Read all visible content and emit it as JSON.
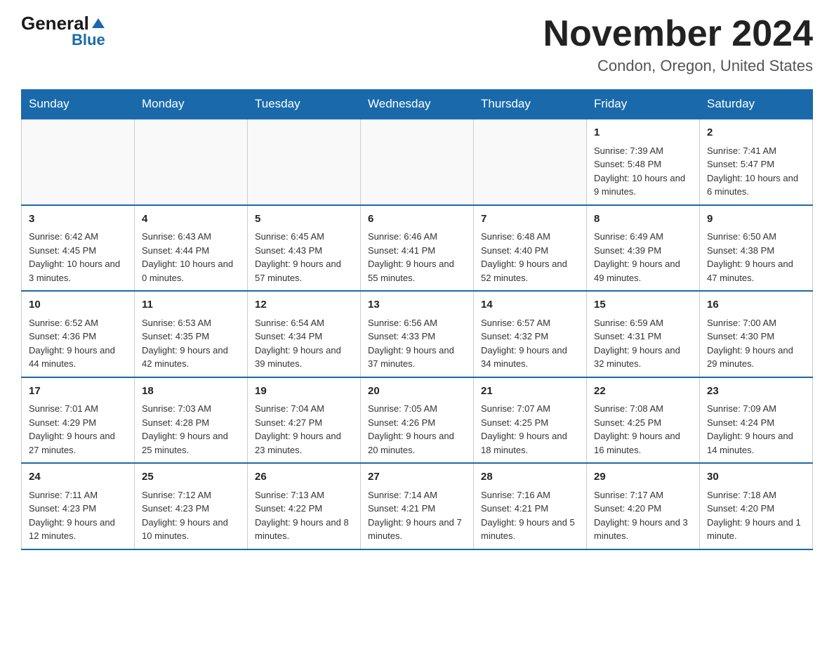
{
  "header": {
    "logo_general": "General",
    "logo_blue": "Blue",
    "month_title": "November 2024",
    "location": "Condon, Oregon, United States"
  },
  "weekdays": [
    "Sunday",
    "Monday",
    "Tuesday",
    "Wednesday",
    "Thursday",
    "Friday",
    "Saturday"
  ],
  "weeks": [
    [
      {
        "day": "",
        "sunrise": "",
        "sunset": "",
        "daylight": ""
      },
      {
        "day": "",
        "sunrise": "",
        "sunset": "",
        "daylight": ""
      },
      {
        "day": "",
        "sunrise": "",
        "sunset": "",
        "daylight": ""
      },
      {
        "day": "",
        "sunrise": "",
        "sunset": "",
        "daylight": ""
      },
      {
        "day": "",
        "sunrise": "",
        "sunset": "",
        "daylight": ""
      },
      {
        "day": "1",
        "sunrise": "Sunrise: 7:39 AM",
        "sunset": "Sunset: 5:48 PM",
        "daylight": "Daylight: 10 hours and 9 minutes."
      },
      {
        "day": "2",
        "sunrise": "Sunrise: 7:41 AM",
        "sunset": "Sunset: 5:47 PM",
        "daylight": "Daylight: 10 hours and 6 minutes."
      }
    ],
    [
      {
        "day": "3",
        "sunrise": "Sunrise: 6:42 AM",
        "sunset": "Sunset: 4:45 PM",
        "daylight": "Daylight: 10 hours and 3 minutes."
      },
      {
        "day": "4",
        "sunrise": "Sunrise: 6:43 AM",
        "sunset": "Sunset: 4:44 PM",
        "daylight": "Daylight: 10 hours and 0 minutes."
      },
      {
        "day": "5",
        "sunrise": "Sunrise: 6:45 AM",
        "sunset": "Sunset: 4:43 PM",
        "daylight": "Daylight: 9 hours and 57 minutes."
      },
      {
        "day": "6",
        "sunrise": "Sunrise: 6:46 AM",
        "sunset": "Sunset: 4:41 PM",
        "daylight": "Daylight: 9 hours and 55 minutes."
      },
      {
        "day": "7",
        "sunrise": "Sunrise: 6:48 AM",
        "sunset": "Sunset: 4:40 PM",
        "daylight": "Daylight: 9 hours and 52 minutes."
      },
      {
        "day": "8",
        "sunrise": "Sunrise: 6:49 AM",
        "sunset": "Sunset: 4:39 PM",
        "daylight": "Daylight: 9 hours and 49 minutes."
      },
      {
        "day": "9",
        "sunrise": "Sunrise: 6:50 AM",
        "sunset": "Sunset: 4:38 PM",
        "daylight": "Daylight: 9 hours and 47 minutes."
      }
    ],
    [
      {
        "day": "10",
        "sunrise": "Sunrise: 6:52 AM",
        "sunset": "Sunset: 4:36 PM",
        "daylight": "Daylight: 9 hours and 44 minutes."
      },
      {
        "day": "11",
        "sunrise": "Sunrise: 6:53 AM",
        "sunset": "Sunset: 4:35 PM",
        "daylight": "Daylight: 9 hours and 42 minutes."
      },
      {
        "day": "12",
        "sunrise": "Sunrise: 6:54 AM",
        "sunset": "Sunset: 4:34 PM",
        "daylight": "Daylight: 9 hours and 39 minutes."
      },
      {
        "day": "13",
        "sunrise": "Sunrise: 6:56 AM",
        "sunset": "Sunset: 4:33 PM",
        "daylight": "Daylight: 9 hours and 37 minutes."
      },
      {
        "day": "14",
        "sunrise": "Sunrise: 6:57 AM",
        "sunset": "Sunset: 4:32 PM",
        "daylight": "Daylight: 9 hours and 34 minutes."
      },
      {
        "day": "15",
        "sunrise": "Sunrise: 6:59 AM",
        "sunset": "Sunset: 4:31 PM",
        "daylight": "Daylight: 9 hours and 32 minutes."
      },
      {
        "day": "16",
        "sunrise": "Sunrise: 7:00 AM",
        "sunset": "Sunset: 4:30 PM",
        "daylight": "Daylight: 9 hours and 29 minutes."
      }
    ],
    [
      {
        "day": "17",
        "sunrise": "Sunrise: 7:01 AM",
        "sunset": "Sunset: 4:29 PM",
        "daylight": "Daylight: 9 hours and 27 minutes."
      },
      {
        "day": "18",
        "sunrise": "Sunrise: 7:03 AM",
        "sunset": "Sunset: 4:28 PM",
        "daylight": "Daylight: 9 hours and 25 minutes."
      },
      {
        "day": "19",
        "sunrise": "Sunrise: 7:04 AM",
        "sunset": "Sunset: 4:27 PM",
        "daylight": "Daylight: 9 hours and 23 minutes."
      },
      {
        "day": "20",
        "sunrise": "Sunrise: 7:05 AM",
        "sunset": "Sunset: 4:26 PM",
        "daylight": "Daylight: 9 hours and 20 minutes."
      },
      {
        "day": "21",
        "sunrise": "Sunrise: 7:07 AM",
        "sunset": "Sunset: 4:25 PM",
        "daylight": "Daylight: 9 hours and 18 minutes."
      },
      {
        "day": "22",
        "sunrise": "Sunrise: 7:08 AM",
        "sunset": "Sunset: 4:25 PM",
        "daylight": "Daylight: 9 hours and 16 minutes."
      },
      {
        "day": "23",
        "sunrise": "Sunrise: 7:09 AM",
        "sunset": "Sunset: 4:24 PM",
        "daylight": "Daylight: 9 hours and 14 minutes."
      }
    ],
    [
      {
        "day": "24",
        "sunrise": "Sunrise: 7:11 AM",
        "sunset": "Sunset: 4:23 PM",
        "daylight": "Daylight: 9 hours and 12 minutes."
      },
      {
        "day": "25",
        "sunrise": "Sunrise: 7:12 AM",
        "sunset": "Sunset: 4:23 PM",
        "daylight": "Daylight: 9 hours and 10 minutes."
      },
      {
        "day": "26",
        "sunrise": "Sunrise: 7:13 AM",
        "sunset": "Sunset: 4:22 PM",
        "daylight": "Daylight: 9 hours and 8 minutes."
      },
      {
        "day": "27",
        "sunrise": "Sunrise: 7:14 AM",
        "sunset": "Sunset: 4:21 PM",
        "daylight": "Daylight: 9 hours and 7 minutes."
      },
      {
        "day": "28",
        "sunrise": "Sunrise: 7:16 AM",
        "sunset": "Sunset: 4:21 PM",
        "daylight": "Daylight: 9 hours and 5 minutes."
      },
      {
        "day": "29",
        "sunrise": "Sunrise: 7:17 AM",
        "sunset": "Sunset: 4:20 PM",
        "daylight": "Daylight: 9 hours and 3 minutes."
      },
      {
        "day": "30",
        "sunrise": "Sunrise: 7:18 AM",
        "sunset": "Sunset: 4:20 PM",
        "daylight": "Daylight: 9 hours and 1 minute."
      }
    ]
  ]
}
